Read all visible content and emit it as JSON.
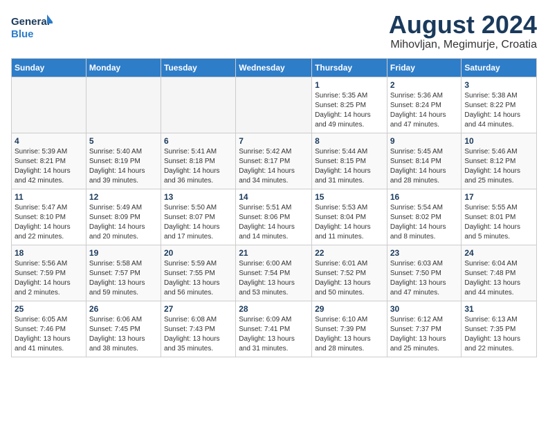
{
  "header": {
    "logo_line1": "General",
    "logo_line2": "Blue",
    "title": "August 2024",
    "subtitle": "Mihovljan, Megimurje, Croatia"
  },
  "weekdays": [
    "Sunday",
    "Monday",
    "Tuesday",
    "Wednesday",
    "Thursday",
    "Friday",
    "Saturday"
  ],
  "weeks": [
    [
      {
        "day": "",
        "info": ""
      },
      {
        "day": "",
        "info": ""
      },
      {
        "day": "",
        "info": ""
      },
      {
        "day": "",
        "info": ""
      },
      {
        "day": "1",
        "info": "Sunrise: 5:35 AM\nSunset: 8:25 PM\nDaylight: 14 hours\nand 49 minutes."
      },
      {
        "day": "2",
        "info": "Sunrise: 5:36 AM\nSunset: 8:24 PM\nDaylight: 14 hours\nand 47 minutes."
      },
      {
        "day": "3",
        "info": "Sunrise: 5:38 AM\nSunset: 8:22 PM\nDaylight: 14 hours\nand 44 minutes."
      }
    ],
    [
      {
        "day": "4",
        "info": "Sunrise: 5:39 AM\nSunset: 8:21 PM\nDaylight: 14 hours\nand 42 minutes."
      },
      {
        "day": "5",
        "info": "Sunrise: 5:40 AM\nSunset: 8:19 PM\nDaylight: 14 hours\nand 39 minutes."
      },
      {
        "day": "6",
        "info": "Sunrise: 5:41 AM\nSunset: 8:18 PM\nDaylight: 14 hours\nand 36 minutes."
      },
      {
        "day": "7",
        "info": "Sunrise: 5:42 AM\nSunset: 8:17 PM\nDaylight: 14 hours\nand 34 minutes."
      },
      {
        "day": "8",
        "info": "Sunrise: 5:44 AM\nSunset: 8:15 PM\nDaylight: 14 hours\nand 31 minutes."
      },
      {
        "day": "9",
        "info": "Sunrise: 5:45 AM\nSunset: 8:14 PM\nDaylight: 14 hours\nand 28 minutes."
      },
      {
        "day": "10",
        "info": "Sunrise: 5:46 AM\nSunset: 8:12 PM\nDaylight: 14 hours\nand 25 minutes."
      }
    ],
    [
      {
        "day": "11",
        "info": "Sunrise: 5:47 AM\nSunset: 8:10 PM\nDaylight: 14 hours\nand 22 minutes."
      },
      {
        "day": "12",
        "info": "Sunrise: 5:49 AM\nSunset: 8:09 PM\nDaylight: 14 hours\nand 20 minutes."
      },
      {
        "day": "13",
        "info": "Sunrise: 5:50 AM\nSunset: 8:07 PM\nDaylight: 14 hours\nand 17 minutes."
      },
      {
        "day": "14",
        "info": "Sunrise: 5:51 AM\nSunset: 8:06 PM\nDaylight: 14 hours\nand 14 minutes."
      },
      {
        "day": "15",
        "info": "Sunrise: 5:53 AM\nSunset: 8:04 PM\nDaylight: 14 hours\nand 11 minutes."
      },
      {
        "day": "16",
        "info": "Sunrise: 5:54 AM\nSunset: 8:02 PM\nDaylight: 14 hours\nand 8 minutes."
      },
      {
        "day": "17",
        "info": "Sunrise: 5:55 AM\nSunset: 8:01 PM\nDaylight: 14 hours\nand 5 minutes."
      }
    ],
    [
      {
        "day": "18",
        "info": "Sunrise: 5:56 AM\nSunset: 7:59 PM\nDaylight: 14 hours\nand 2 minutes."
      },
      {
        "day": "19",
        "info": "Sunrise: 5:58 AM\nSunset: 7:57 PM\nDaylight: 13 hours\nand 59 minutes."
      },
      {
        "day": "20",
        "info": "Sunrise: 5:59 AM\nSunset: 7:55 PM\nDaylight: 13 hours\nand 56 minutes."
      },
      {
        "day": "21",
        "info": "Sunrise: 6:00 AM\nSunset: 7:54 PM\nDaylight: 13 hours\nand 53 minutes."
      },
      {
        "day": "22",
        "info": "Sunrise: 6:01 AM\nSunset: 7:52 PM\nDaylight: 13 hours\nand 50 minutes."
      },
      {
        "day": "23",
        "info": "Sunrise: 6:03 AM\nSunset: 7:50 PM\nDaylight: 13 hours\nand 47 minutes."
      },
      {
        "day": "24",
        "info": "Sunrise: 6:04 AM\nSunset: 7:48 PM\nDaylight: 13 hours\nand 44 minutes."
      }
    ],
    [
      {
        "day": "25",
        "info": "Sunrise: 6:05 AM\nSunset: 7:46 PM\nDaylight: 13 hours\nand 41 minutes."
      },
      {
        "day": "26",
        "info": "Sunrise: 6:06 AM\nSunset: 7:45 PM\nDaylight: 13 hours\nand 38 minutes."
      },
      {
        "day": "27",
        "info": "Sunrise: 6:08 AM\nSunset: 7:43 PM\nDaylight: 13 hours\nand 35 minutes."
      },
      {
        "day": "28",
        "info": "Sunrise: 6:09 AM\nSunset: 7:41 PM\nDaylight: 13 hours\nand 31 minutes."
      },
      {
        "day": "29",
        "info": "Sunrise: 6:10 AM\nSunset: 7:39 PM\nDaylight: 13 hours\nand 28 minutes."
      },
      {
        "day": "30",
        "info": "Sunrise: 6:12 AM\nSunset: 7:37 PM\nDaylight: 13 hours\nand 25 minutes."
      },
      {
        "day": "31",
        "info": "Sunrise: 6:13 AM\nSunset: 7:35 PM\nDaylight: 13 hours\nand 22 minutes."
      }
    ]
  ]
}
